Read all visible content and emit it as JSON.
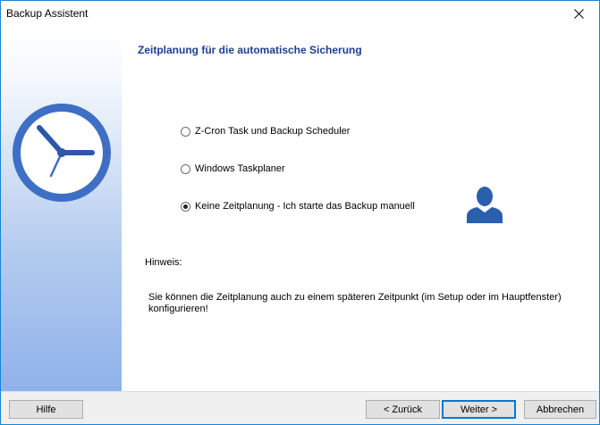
{
  "window": {
    "title": "Backup Assistent",
    "close_glyph": "✕"
  },
  "sidebar": {
    "icon": "clock-icon"
  },
  "main": {
    "heading": "Zeitplanung für die automatische Sicherung",
    "options": [
      {
        "label": "Z-Cron Task und Backup Scheduler",
        "checked": false
      },
      {
        "label": "Windows Taskplaner",
        "checked": false
      },
      {
        "label": "Keine Zeitplanung - Ich starte das Backup manuell",
        "checked": true
      }
    ],
    "user_icon": "user-icon",
    "note_label": "Hinweis:",
    "note_text": "Sie können die Zeitplanung auch zu einem späteren Zeitpunkt (im Setup oder im Hauptfenster) konfigurieren!"
  },
  "buttons": {
    "help": "Hilfe",
    "back": "< Zurück",
    "next": "Weiter >",
    "cancel": "Abbrechen"
  },
  "colors": {
    "heading": "#1c3f8f",
    "clock_face": "#3f6fc4",
    "accent_border": "#0078d7"
  }
}
